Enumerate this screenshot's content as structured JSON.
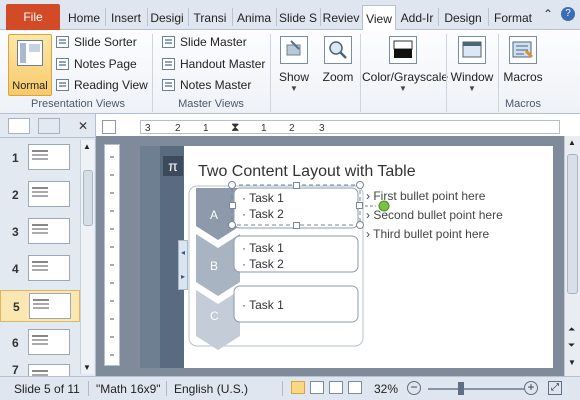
{
  "tabs": [
    "File",
    "Home",
    "Insert",
    "Design",
    "Transitions",
    "Animations",
    "Slide Show",
    "Review",
    "View",
    "Add-Ins",
    "Design",
    "Format"
  ],
  "tab_display": [
    "File",
    "Home",
    "Insert",
    "Desigi",
    "Transi",
    "Anima",
    "Slide S",
    "Reviev",
    "View",
    "Add-Ir",
    "Design",
    "Format"
  ],
  "active_tab": "View",
  "ribbon": {
    "presentation_views": {
      "label": "Presentation Views",
      "normal": "Normal",
      "slide_sorter": "Slide Sorter",
      "notes_page": "Notes Page",
      "reading_view": "Reading View"
    },
    "master_views": {
      "label": "Master Views",
      "slide_master": "Slide Master",
      "handout_master": "Handout Master",
      "notes_master": "Notes Master"
    },
    "show": "Show",
    "zoom": "Zoom",
    "color_grayscale": "Color/Grayscale",
    "window": "Window",
    "macros": {
      "button": "Macros",
      "label": "Macros"
    }
  },
  "thumbnails": [
    "1",
    "2",
    "3",
    "4",
    "5",
    "6",
    "7"
  ],
  "selected_thumbnail": "5",
  "ruler_numbers": [
    "3",
    "2",
    "1",
    "0",
    "1",
    "2",
    "3"
  ],
  "slide": {
    "title": "Two Content Layout with Table",
    "logo": "π",
    "chevrons": [
      "A",
      "B",
      "C"
    ],
    "tasks": {
      "a": [
        "· Task 1",
        "· Task 2"
      ],
      "b": [
        "· Task 1",
        "· Task 2"
      ],
      "c": [
        "· Task 1"
      ]
    },
    "bullets": [
      "› First bullet point here",
      "› Second bullet point here",
      "› Third bullet point here"
    ]
  },
  "status": {
    "slide": "Slide 5 of 11",
    "theme": "\"Math 16x9\"",
    "language": "English (U.S.)",
    "zoom": "32%",
    "zoom_minus": "−",
    "zoom_plus": "+"
  },
  "colors": {
    "file_tab": "#d24a26",
    "selected_button": "#f7c96a",
    "chevron": "#8e9aab"
  }
}
